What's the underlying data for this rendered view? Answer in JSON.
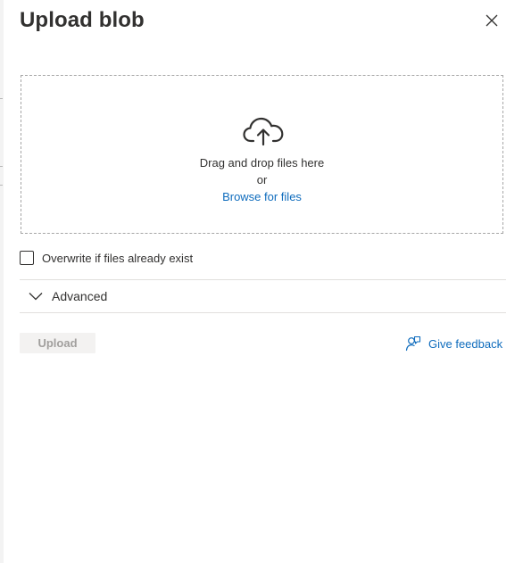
{
  "panel": {
    "title": "Upload blob",
    "close_icon": "close-icon"
  },
  "dropzone": {
    "icon": "cloud-upload-icon",
    "drag_text": "Drag and drop files here",
    "or_text": "or",
    "browse_link": "Browse for files"
  },
  "overwrite": {
    "label": "Overwrite if files already exist",
    "checked": false
  },
  "advanced": {
    "label": "Advanced",
    "icon": "chevron-down-icon",
    "expanded": false
  },
  "actions": {
    "upload_label": "Upload",
    "upload_disabled": true,
    "feedback_label": "Give feedback",
    "feedback_icon": "feedback-person-icon"
  },
  "colors": {
    "link": "#0f6cbd",
    "text": "#323130",
    "disabled_bg": "#f3f2f1",
    "disabled_text": "#a19f9d",
    "border_dashed": "#a6a6a6",
    "divider": "#e1dfdd"
  }
}
